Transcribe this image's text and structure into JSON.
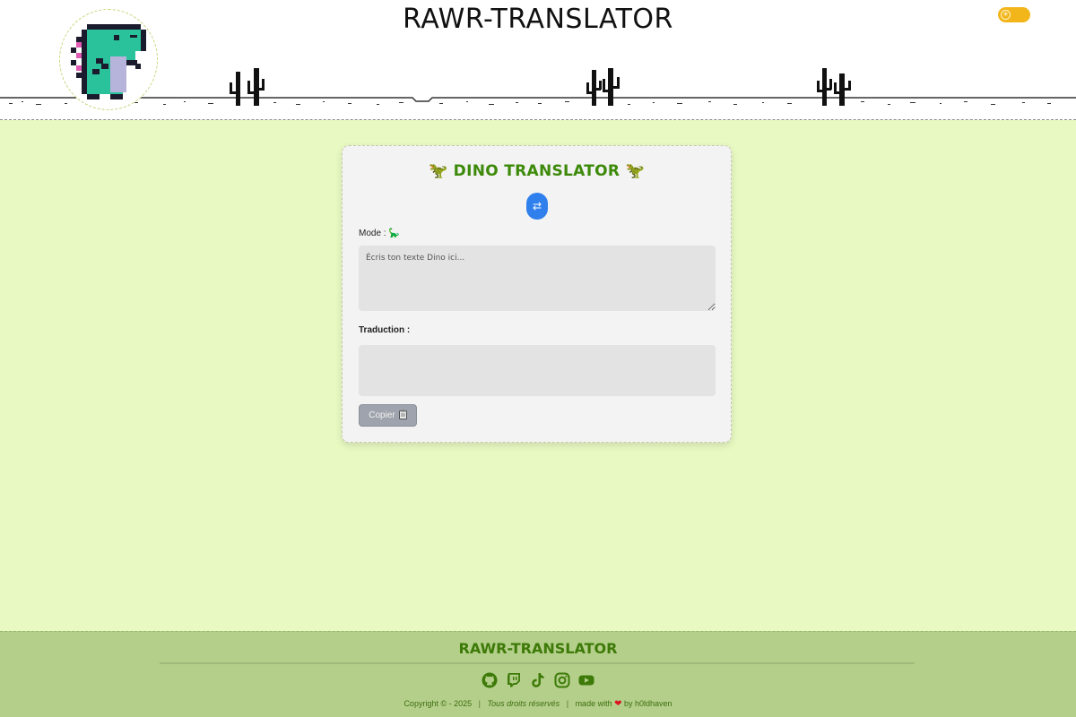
{
  "header": {
    "title": "RAWR-TRANSLATOR",
    "theme_toggle_icon": "sun-icon",
    "theme_toggle_color": "#f2b51a"
  },
  "card": {
    "title": "🦖 DINO TRANSLATOR 🦖",
    "title_color": "#3d8a0a",
    "swap_icon": "⇄",
    "mode_label": "Mode : 🦕",
    "input_placeholder": "Écris ton texte Dino ici...",
    "input_value": "",
    "translation_label": "Traduction :",
    "translation_value": "",
    "copy_label": "Copier",
    "copy_icon": "clipboard-icon"
  },
  "footer": {
    "title": "RAWR-TRANSLATOR",
    "socials": [
      "github-icon",
      "twitch-icon",
      "tiktok-icon",
      "instagram-icon",
      "youtube-icon"
    ],
    "copyright": "Copyright © - 2025",
    "rights": "Tous droits réservés",
    "made_with": "made with",
    "by": "by h0ldhaven",
    "accent": "#3d7a08"
  }
}
